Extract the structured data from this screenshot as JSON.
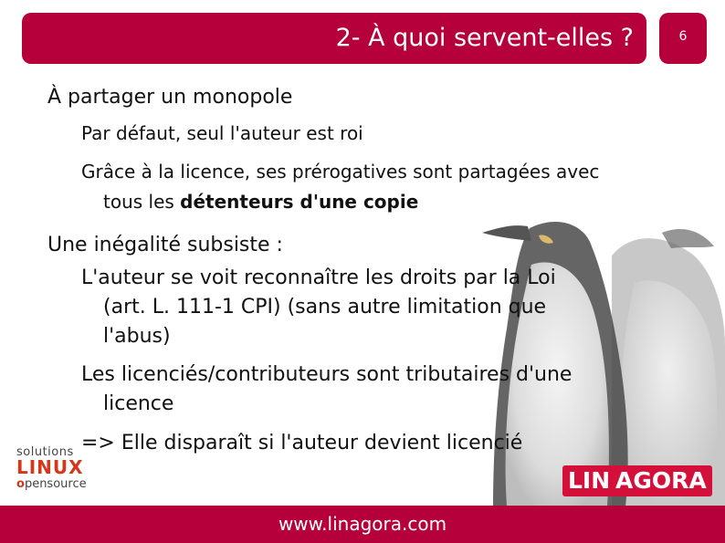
{
  "slide": {
    "title": "2- À quoi servent-elles ?",
    "page_number": "6"
  },
  "content": {
    "heading1": "À partager un monopole",
    "item1": "Par défaut, seul l'auteur est roi",
    "item2_line1": "Grâce à la licence, ses prérogatives sont partagées avec",
    "item2_line2_pre": "tous les ",
    "item2_line2_bold": "détenteurs d'une copie",
    "heading2": "Une inégalité subsiste :",
    "item3_line1": "L'auteur se voit reconnaître les droits par la Loi",
    "item3_line2": "(art. L. 111-1 CPI) (sans autre limitation que",
    "item3_line3": "l'abus)",
    "item4_line1": "Les licenciés/contributeurs sont tributaires d'une",
    "item4_line2": "licence",
    "item5": "=> Elle disparaît si l'auteur devient licencié"
  },
  "logos": {
    "solutions_top": "solutions",
    "solutions_mid": "LINUX",
    "solutions_bottom_o": "o",
    "solutions_bottom_rest": "pensource",
    "linagora_lin": "LIN",
    "linagora_rest": "AGORA"
  },
  "footer": {
    "url": "www.linagora.com"
  },
  "colors": {
    "brand": "#b5003b",
    "text": "#111111"
  }
}
